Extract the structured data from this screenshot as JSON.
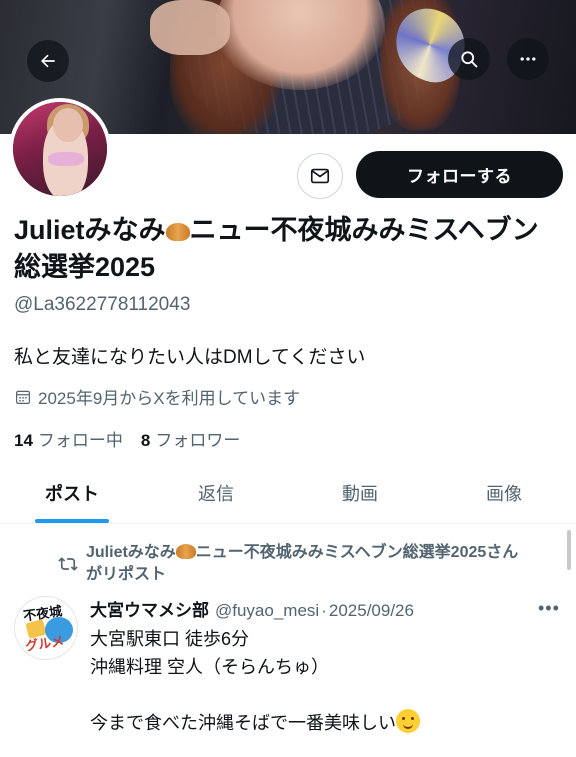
{
  "header": {
    "back_icon": "arrow-left-icon",
    "search_icon": "search-icon",
    "more_icon": "more-horizontal-icon"
  },
  "profile": {
    "name_text": "Julietみなみ",
    "name_emoji": "croissant-emoji",
    "name_rest": "ニュー不夜城みみミスヘブン総選挙2025",
    "handle": "@La3622778112043",
    "bio": "私と友達になりたい人はDMしてください",
    "joined": "2025年9月からXを利用しています",
    "following_count": "14",
    "following_label": "フォロー中",
    "followers_count": "8",
    "followers_label": "フォロワー",
    "follow_button": "フォローする",
    "message_icon": "envelope-icon"
  },
  "tabs": [
    {
      "label": "ポスト",
      "active": true
    },
    {
      "label": "返信",
      "active": false
    },
    {
      "label": "動画",
      "active": false
    },
    {
      "label": "画像",
      "active": false
    }
  ],
  "post": {
    "repost_name": "Julietみなみ",
    "repost_rest": "ニュー不夜城みみミスヘブン総選挙2025さんがリポスト",
    "author_name": "大宮ウマメシ部",
    "author_handle": "@fuyao_mesi",
    "date": "2025/09/26",
    "avatar_text_1": "不夜城",
    "avatar_text_2": "グルメ",
    "lines": [
      "大宮駅東口 徒歩6分",
      "沖縄料理 空人（そらんちゅ）",
      "",
      "今まで食べた沖縄そばで一番美味しい"
    ]
  },
  "colors": {
    "accent": "#1d9bf0",
    "text": "#0f1419",
    "muted": "#536471",
    "follow_bg": "#0f1419"
  }
}
